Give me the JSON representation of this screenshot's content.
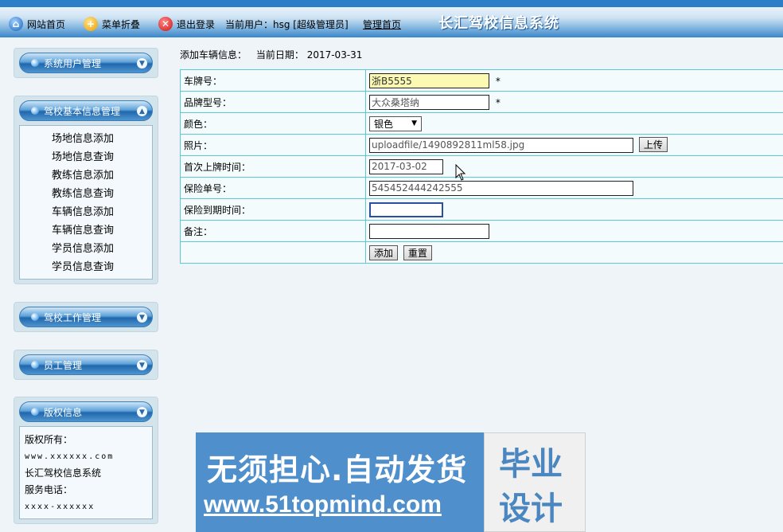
{
  "topbar": {
    "home_label": "网站首页",
    "fold_label": "菜单折叠",
    "logout_label": "退出登录",
    "current_user": "当前用户：hsg [超级管理员]",
    "admin_home": "管理首页",
    "system_name": "长汇驾校信息系统"
  },
  "sidebar": {
    "panel_user": "系统用户管理",
    "panel_basic": "驾校基本信息管理",
    "basic_items": [
      "场地信息添加",
      "场地信息查询",
      "教练信息添加",
      "教练信息查询",
      "车辆信息添加",
      "车辆信息查询",
      "学员信息添加",
      "学员信息查询"
    ],
    "panel_work": "驾校工作管理",
    "panel_staff": "员工管理",
    "panel_copyright": "版权信息",
    "copyright_lines": [
      "版权所有：",
      "www.xxxxxx.com",
      "长汇驾校信息系统",
      "服务电话：",
      "xxxx-xxxxxx"
    ]
  },
  "main": {
    "heading": "添加车辆信息：",
    "date_label": "当前日期：",
    "date_value": "2017-03-31",
    "fields": {
      "plate_label": "车牌号：",
      "plate_value": "浙B5555",
      "brand_label": "品牌型号：",
      "brand_value": "大众桑塔纳",
      "color_label": "颜色：",
      "color_value": "银色",
      "photo_label": "照片：",
      "photo_value": "uploadfile/1490892811ml58.jpg",
      "upload_btn": "上传",
      "first_date_label": "首次上牌时间：",
      "first_date_value": "2017-03-02",
      "policy_label": "保险单号：",
      "policy_value": "545452444242555",
      "expire_label": "保险到期时间：",
      "expire_value": "",
      "remark_label": "备注：",
      "remark_value": "",
      "required_mark": "*"
    },
    "add_btn": "添加",
    "reset_btn": "重置"
  },
  "banner": {
    "line1": "无须担心.自动发货",
    "line2": "www.51topmind.com",
    "box1": "毕业",
    "box2": "设计"
  },
  "colors": {
    "topbar": "#3a86c9",
    "table_border": "#5cc8d6",
    "required_input": "#fcf9b3",
    "banner": "#4f8fcb"
  }
}
